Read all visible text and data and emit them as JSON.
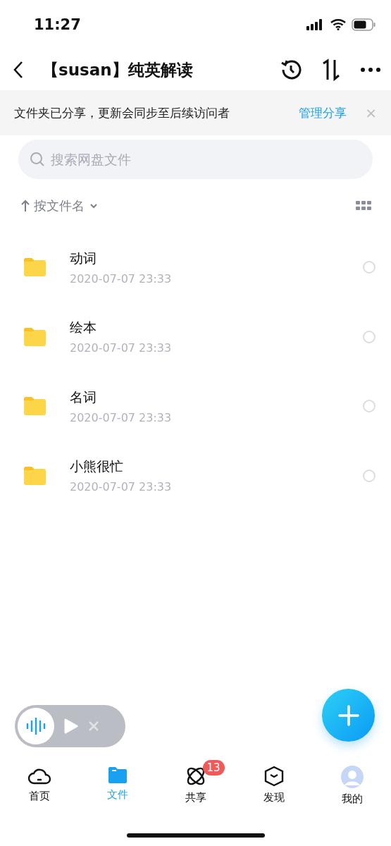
{
  "status_bar": {
    "time": "11:27"
  },
  "header": {
    "title": "【susan】纯英解读"
  },
  "share_banner": {
    "message": "文件夹已分享，更新会同步至后续访问者",
    "action": "管理分享",
    "close": "×"
  },
  "search": {
    "placeholder": "搜索网盘文件"
  },
  "sort": {
    "label": "按文件名"
  },
  "files": [
    {
      "name": "动词",
      "date": "2020-07-07 23:33",
      "selected": false
    },
    {
      "name": "绘本",
      "date": "2020-07-07 23:33",
      "selected": false
    },
    {
      "name": "名词",
      "date": "2020-07-07 23:33",
      "selected": false
    },
    {
      "name": "小熊很忙",
      "date": "2020-07-07 23:33",
      "selected": false
    }
  ],
  "tabs": [
    {
      "kind": "home",
      "label": "首页",
      "selected": false
    },
    {
      "kind": "files",
      "label": "文件",
      "selected": true
    },
    {
      "kind": "share",
      "label": "共享",
      "selected": false,
      "badge": "13"
    },
    {
      "kind": "discover",
      "label": "发现",
      "selected": false
    },
    {
      "kind": "me",
      "label": "我的",
      "selected": false
    }
  ]
}
